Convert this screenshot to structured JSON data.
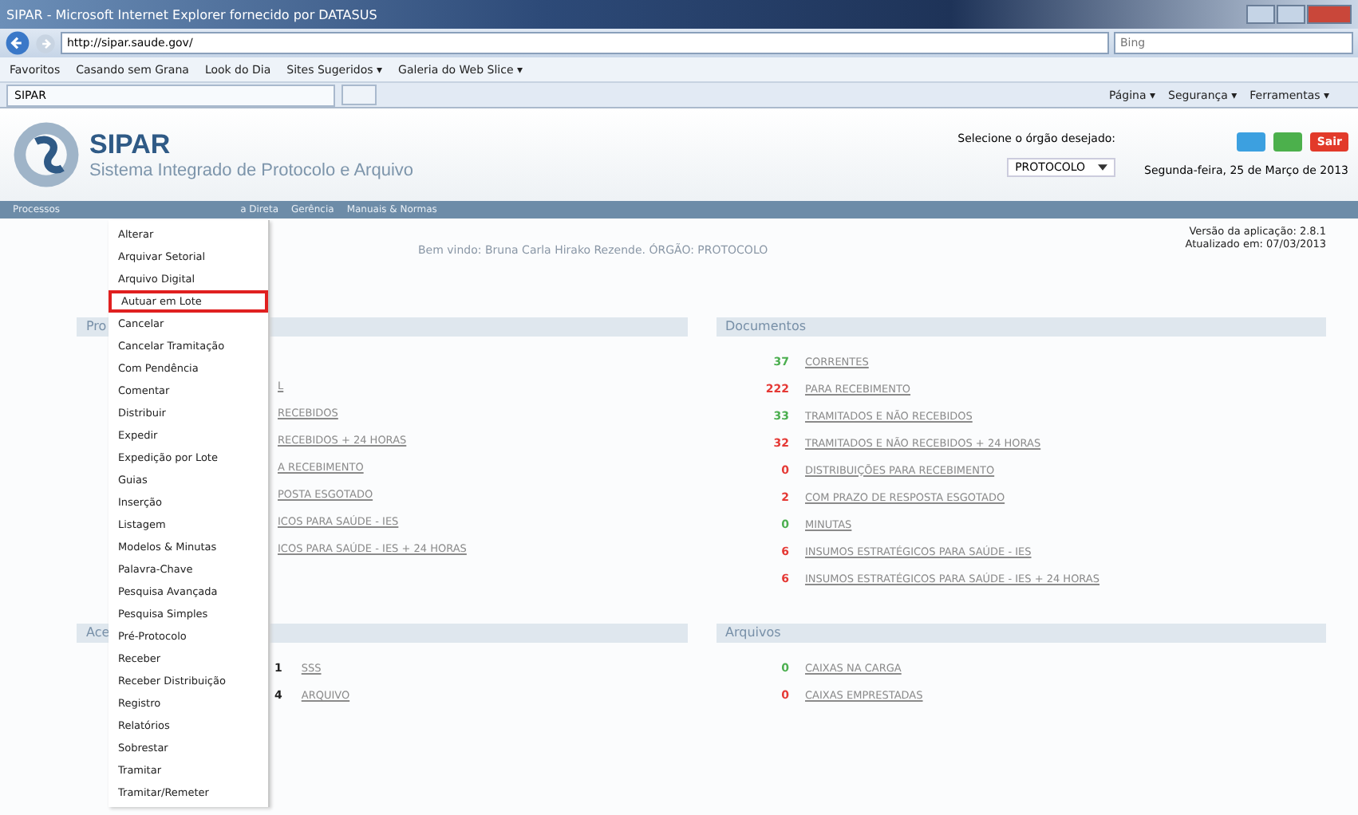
{
  "browser": {
    "title": "SIPAR - Microsoft Internet Explorer fornecido por DATASUS",
    "address": "http://sipar.saude.gov/",
    "search_placeholder": "Bing",
    "favorites_label": "Favoritos",
    "favorites": [
      "Casando sem Grana",
      "Look do Dia",
      "Sites Sugeridos ▾",
      "Galeria do Web Slice ▾"
    ],
    "tab": "SIPAR",
    "commands": [
      "Página ▾",
      "Segurança ▾",
      "Ferramentas ▾"
    ]
  },
  "header": {
    "title": "SIPAR",
    "subtitle": "Sistema Integrado de Protocolo e Arquivo",
    "organ_label": "Selecione o órgão desejado:",
    "organ_select": "PROTOCOLO",
    "date": "Segunda-feira, 25 de Março de 2013",
    "exit": "Sair"
  },
  "nav": [
    "Processos",
    "a Direta",
    "Gerência",
    "Manuais & Normas"
  ],
  "menu": [
    {
      "label": "Alterar",
      "selected": false
    },
    {
      "label": "Arquivar Setorial",
      "selected": false
    },
    {
      "label": "Arquivo Digital",
      "selected": false
    },
    {
      "label": "Autuar em Lote",
      "selected": true
    },
    {
      "label": "Cancelar",
      "selected": false
    },
    {
      "label": "Cancelar Tramitação",
      "selected": false
    },
    {
      "label": "Com Pendência",
      "selected": false
    },
    {
      "label": "Comentar",
      "selected": false
    },
    {
      "label": "Distribuir",
      "selected": false
    },
    {
      "label": "Expedir",
      "selected": false
    },
    {
      "label": "Expedição por Lote",
      "selected": false
    },
    {
      "label": "Guias",
      "selected": false
    },
    {
      "label": "Inserção",
      "selected": false
    },
    {
      "label": "Listagem",
      "selected": false
    },
    {
      "label": "Modelos & Minutas",
      "selected": false
    },
    {
      "label": "Palavra-Chave",
      "selected": false
    },
    {
      "label": "Pesquisa Avançada",
      "selected": false
    },
    {
      "label": "Pesquisa Simples",
      "selected": false
    },
    {
      "label": "Pré-Protocolo",
      "selected": false
    },
    {
      "label": "Receber",
      "selected": false
    },
    {
      "label": "Receber Distribuição",
      "selected": false
    },
    {
      "label": "Registro",
      "selected": false
    },
    {
      "label": "Relatórios",
      "selected": false
    },
    {
      "label": "Sobrestar",
      "selected": false
    },
    {
      "label": "Tramitar",
      "selected": false
    },
    {
      "label": "Tramitar/Remeter",
      "selected": false
    }
  ],
  "welcome": "Bem vindo: Bruna Carla Hirako Rezende. ÓRGÃO: PROTOCOLO",
  "version": [
    "Versão da aplicação: 2.8.1",
    "Atualizado em: 07/03/2013"
  ],
  "left_panels": [
    {
      "title": "Pro",
      "rows": [
        {
          "count": "",
          "label": "L"
        },
        {
          "count": "",
          "label": "RECEBIDOS"
        },
        {
          "count": "",
          "label": "RECEBIDOS + 24 HORAS"
        },
        {
          "count": "",
          "label": "A RECEBIMENTO"
        },
        {
          "count": "",
          "label": "POSTA ESGOTADO"
        },
        {
          "count": "",
          "label": "ICOS PARA SAÚDE - IES"
        },
        {
          "count": "",
          "label": "ICOS PARA SAÚDE - IES + 24 HORAS"
        }
      ]
    },
    {
      "title": "Ace",
      "rows": [
        {
          "count": "1",
          "label": "SSS"
        },
        {
          "count": "4",
          "label": "ARQUIVO"
        }
      ]
    }
  ],
  "right_panels": [
    {
      "title": "Documentos",
      "rows": [
        {
          "count": "37",
          "color": "#4caf50",
          "label": "CORRENTES"
        },
        {
          "count": "222",
          "color": "#e53935",
          "label": "PARA RECEBIMENTO"
        },
        {
          "count": "33",
          "color": "#4caf50",
          "label": "TRAMITADOS E NÃO RECEBIDOS"
        },
        {
          "count": "32",
          "color": "#e53935",
          "label": "TRAMITADOS E NÃO RECEBIDOS + 24 HORAS"
        },
        {
          "count": "0",
          "color": "#e53935",
          "label": "DISTRIBUIÇÕES PARA RECEBIMENTO"
        },
        {
          "count": "2",
          "color": "#e53935",
          "label": "COM PRAZO DE RESPOSTA ESGOTADO"
        },
        {
          "count": "0",
          "color": "#4caf50",
          "label": "MINUTAS"
        },
        {
          "count": "6",
          "color": "#e53935",
          "label": "INSUMOS ESTRATÉGICOS PARA SAÚDE - IES"
        },
        {
          "count": "6",
          "color": "#e53935",
          "label": "INSUMOS ESTRATÉGICOS PARA SAÚDE - IES + 24 HORAS"
        }
      ]
    },
    {
      "title": "Arquivos",
      "rows": [
        {
          "count": "0",
          "color": "#4caf50",
          "label": "CAIXAS NA CARGA"
        },
        {
          "count": "0",
          "color": "#e53935",
          "label": "CAIXAS EMPRESTADAS"
        }
      ]
    }
  ]
}
